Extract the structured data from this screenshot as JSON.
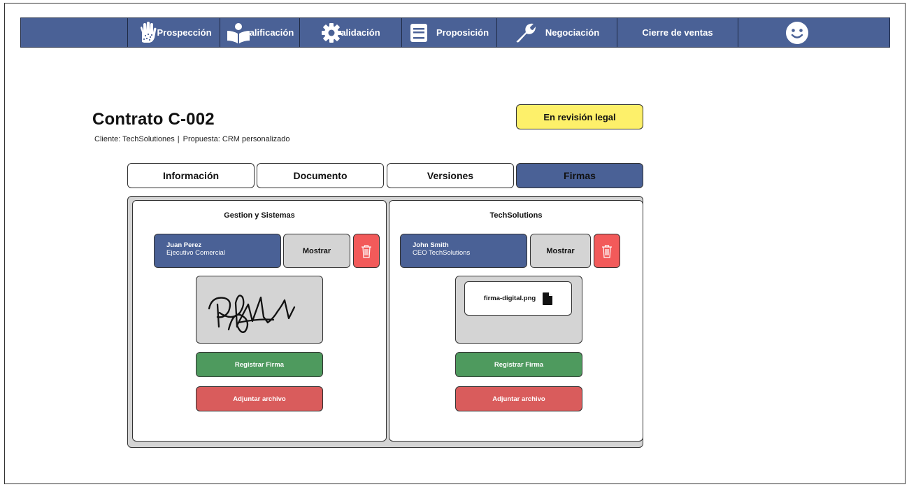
{
  "nav": {
    "items": [
      {
        "label": "Prospección",
        "icon": "hand-icon"
      },
      {
        "label": "alificación",
        "icon": "reader-icon"
      },
      {
        "label": "alidación",
        "icon": "gear-icon"
      },
      {
        "label": "Proposición",
        "icon": "document-icon"
      },
      {
        "label": "Negociación",
        "icon": "wrench-icon"
      },
      {
        "label": "Cierre de ventas",
        "icon": ""
      }
    ],
    "user_icon": "smiley-icon"
  },
  "contract": {
    "title": "Contrato C-002",
    "client": "Cliente: TechSolutiones",
    "proposal": "Propuesta: CRM personalizado",
    "separator": "|",
    "status": "En revisión legal"
  },
  "tabs": [
    {
      "label": "Información",
      "active": false
    },
    {
      "label": "Documento",
      "active": false
    },
    {
      "label": "Versiones",
      "active": false
    },
    {
      "label": "Firmas",
      "active": true
    }
  ],
  "signatures": {
    "left": {
      "company": "Gestion y Sistemas",
      "signer_name": "Juan Perez",
      "signer_role": "Ejecutivo Comercial",
      "show_label": "Mostrar",
      "register_label": "Registrar Firma",
      "attach_label": "Adjuntar archivo"
    },
    "right": {
      "company": "TechSolutions",
      "signer_name": "John Smith",
      "signer_role": "CEO TechSolutions",
      "show_label": "Mostrar",
      "file_name": "firma-digital.png",
      "register_label": "Registrar Firma",
      "attach_label": "Adjuntar archivo"
    }
  },
  "colors": {
    "nav_bg": "#4a6196",
    "status_bg": "#fdf06a",
    "register": "#4e9a5e",
    "attach": "#d95c5c",
    "delete": "#f25a5a"
  }
}
